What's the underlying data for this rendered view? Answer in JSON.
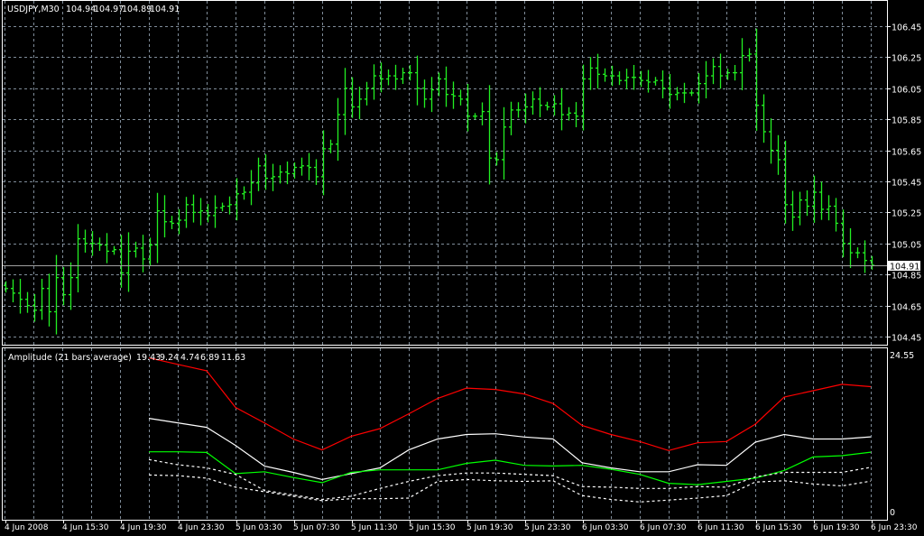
{
  "header": {
    "symbol": "USDJPY,M30",
    "open": "104.94",
    "high": "104.97",
    "low": "104.89",
    "close": "104.91"
  },
  "indicator": {
    "name": "Amplitude (21 bars average)",
    "separator": "-",
    "values": [
      "19.43",
      "9.24",
      "4.74",
      "6.89",
      "11.63"
    ],
    "axis_max": "24.55",
    "axis_min": "0"
  },
  "colors": {
    "background": "#000000",
    "bars": "#22ee22",
    "grid": "#7f8c99",
    "red_line": "#ff0000",
    "white_line": "#ffffff",
    "green_line": "#00ff00"
  },
  "chart_data": [
    {
      "type": "ohlc",
      "title": "USDJPY,M30",
      "ylim": [
        104.45,
        106.45
      ],
      "price_ticks": [
        "106.45",
        "106.25",
        "106.05",
        "105.85",
        "105.65",
        "105.45",
        "105.25",
        "105.05",
        "104.85",
        "104.65",
        "104.45"
      ],
      "current_price": "104.91",
      "x_tick_labels": [
        "4 Jun 2008",
        "4 Jun 15:30",
        "4 Jun 19:30",
        "4 Jun 23:30",
        "5 Jun 03:30",
        "5 Jun 07:30",
        "5 Jun 11:30",
        "5 Jun 15:30",
        "5 Jun 19:30",
        "5 Jun 23:30",
        "6 Jun 03:30",
        "6 Jun 07:30",
        "6 Jun 11:30",
        "6 Jun 15:30",
        "6 Jun 19:30",
        "6 Jun 23:30"
      ],
      "close": [
        104.76,
        104.73,
        104.69,
        104.65,
        104.62,
        104.76,
        104.61,
        104.83,
        104.72,
        104.83,
        105.08,
        105.05,
        105.05,
        105.04,
        105.0,
        105.01,
        104.86,
        105.0,
        105.02,
        104.95,
        105.04,
        105.26,
        105.19,
        105.18,
        105.2,
        105.3,
        105.25,
        105.26,
        105.23,
        105.28,
        105.29,
        105.3,
        105.37,
        105.38,
        105.44,
        105.55,
        105.47,
        105.48,
        105.51,
        105.5,
        105.54,
        105.55,
        105.54,
        105.48,
        105.66,
        105.69,
        105.88,
        106.05,
        105.93,
        105.98,
        106.05,
        106.13,
        106.11,
        106.13,
        106.11,
        106.15,
        106.15,
        106.05,
        105.98,
        106.04,
        106.11,
        106.01,
        106.0,
        105.98,
        105.87,
        105.87,
        105.9,
        105.6,
        105.59,
        105.8,
        105.91,
        105.91,
        105.93,
        105.98,
        105.94,
        105.93,
        105.95,
        105.88,
        105.89,
        105.87,
        106.11,
        106.18,
        106.14,
        106.13,
        106.13,
        106.1,
        106.12,
        106.12,
        106.1,
        106.09,
        106.1,
        106.05,
        106.01,
        106.02,
        106.02,
        106.02,
        106.08,
        106.13,
        106.19,
        106.13,
        106.15,
        106.15,
        106.26,
        106.27,
        105.94,
        105.77,
        105.65,
        105.59,
        105.3,
        105.22,
        105.33,
        105.29,
        105.38,
        105.27,
        105.29,
        105.18,
        105.05,
        104.99,
        104.99,
        104.94,
        104.91
      ]
    },
    {
      "type": "line",
      "title": "Amplitude (21 bars average)",
      "ylim": [
        0,
        24.55
      ],
      "x_bar_start": 20,
      "x_bar_step": 4,
      "series": [
        {
          "name": "red",
          "color": "#ff0000",
          "dashed": false,
          "values": [
            23.9,
            22.9,
            21.9,
            16.2,
            13.8,
            11.3,
            9.6,
            11.7,
            12.9,
            15.2,
            17.6,
            19.2,
            19.0,
            18.3,
            16.8,
            13.4,
            12.0,
            10.9,
            9.5,
            10.7,
            10.9,
            13.6,
            17.8,
            18.8,
            19.8,
            19.43
          ]
        },
        {
          "name": "white",
          "color": "#ffffff",
          "dashed": false,
          "values": [
            14.5,
            13.8,
            13.1,
            10.3,
            7.1,
            6.1,
            5.0,
            5.9,
            6.8,
            9.6,
            11.3,
            12.0,
            12.1,
            11.6,
            11.3,
            7.6,
            6.8,
            6.2,
            6.2,
            7.3,
            7.2,
            10.8,
            12.0,
            11.3,
            11.3,
            11.63
          ]
        },
        {
          "name": "green",
          "color": "#00ff00",
          "dashed": false,
          "values": [
            9.3,
            9.3,
            9.2,
            5.9,
            6.2,
            5.3,
            4.5,
            6.1,
            6.5,
            6.5,
            6.5,
            7.5,
            8.0,
            7.2,
            7.1,
            7.2,
            6.6,
            5.8,
            4.4,
            4.2,
            4.7,
            5.2,
            6.4,
            8.5,
            8.7,
            9.24
          ]
        },
        {
          "name": "upper-dashed",
          "color": "#ffffff",
          "dashed": true,
          "values": [
            8.1,
            7.3,
            6.8,
            5.8,
            3.3,
            2.6,
            1.9,
            2.4,
            3.6,
            4.7,
            5.6,
            6.0,
            6.0,
            5.8,
            5.6,
            3.9,
            3.8,
            3.6,
            3.6,
            3.9,
            3.8,
            5.4,
            6.1,
            6.1,
            6.1,
            6.89
          ]
        },
        {
          "name": "lower-dashed",
          "color": "#ffffff",
          "dashed": true,
          "values": [
            5.7,
            5.6,
            5.2,
            3.8,
            3.1,
            2.4,
            1.7,
            2.0,
            2.0,
            2.1,
            4.7,
            5.0,
            4.8,
            4.7,
            4.8,
            2.5,
            1.9,
            1.5,
            1.8,
            2.1,
            2.5,
            4.6,
            4.8,
            4.3,
            4.0,
            4.74
          ]
        }
      ]
    }
  ]
}
